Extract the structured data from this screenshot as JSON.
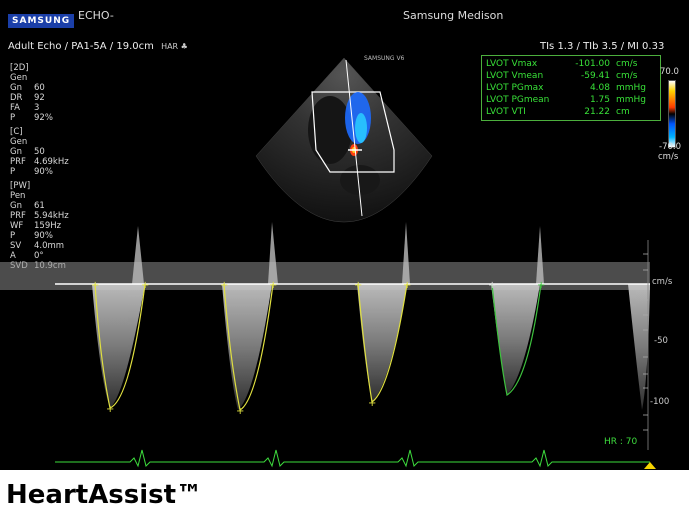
{
  "header": {
    "brand": "SAMSUNG",
    "echo_tag": "ECHO-",
    "manufacturer": "Samsung Medison",
    "preset": "Adult Echo / PA1-5A / 19.0cm",
    "thermal": "TIs  1.3 / TIb  3.5 / MI  0.33"
  },
  "probe_label": "SAMSUNG V6",
  "params": {
    "twod": {
      "title": "[2D]",
      "rows": [
        [
          "Gen",
          ""
        ],
        [
          "Gn",
          "60"
        ],
        [
          "DR",
          "92"
        ],
        [
          "FA",
          "3"
        ],
        [
          "P",
          "92%"
        ]
      ]
    },
    "color": {
      "title": "[C]",
      "rows": [
        [
          "Gen",
          ""
        ],
        [
          "Gn",
          "50"
        ],
        [
          "PRF",
          "4.69kHz"
        ],
        [
          "P",
          "90%"
        ]
      ]
    },
    "pw": {
      "title": "[PW]",
      "rows": [
        [
          "Pen",
          ""
        ],
        [
          "Gn",
          "61"
        ],
        [
          "PRF",
          "5.94kHz"
        ],
        [
          "WF",
          "159Hz"
        ],
        [
          "P",
          "90%"
        ],
        [
          "SV",
          "4.0mm"
        ],
        [
          "A",
          "0°"
        ],
        [
          "SVD",
          "10.9cm"
        ]
      ]
    }
  },
  "measurements": [
    {
      "label": "LVOT Vmax",
      "value": "-101.00",
      "unit": "cm/s"
    },
    {
      "label": "LVOT Vmean",
      "value": "-59.41",
      "unit": "cm/s"
    },
    {
      "label": "LVOT PGmax",
      "value": "4.08",
      "unit": "mmHg"
    },
    {
      "label": "LVOT PGmean",
      "value": "1.75",
      "unit": "mmHg"
    },
    {
      "label": "LVOT VTI",
      "value": "21.22",
      "unit": "cm"
    }
  ],
  "colorbar": {
    "top": "70.0",
    "bottom": "-70.0",
    "unit": "cm/s"
  },
  "doppler_scale": {
    "unit": "cm/s",
    "minus50": "-50",
    "minus100": "-100"
  },
  "hr": "HR : 70",
  "footer_title": "HeartAssist™",
  "colors": {
    "trace_yellow": "#e0e040",
    "trace_green": "#3ec23e",
    "ecg": "#3ddc3d",
    "measure_text": "#38e038"
  }
}
